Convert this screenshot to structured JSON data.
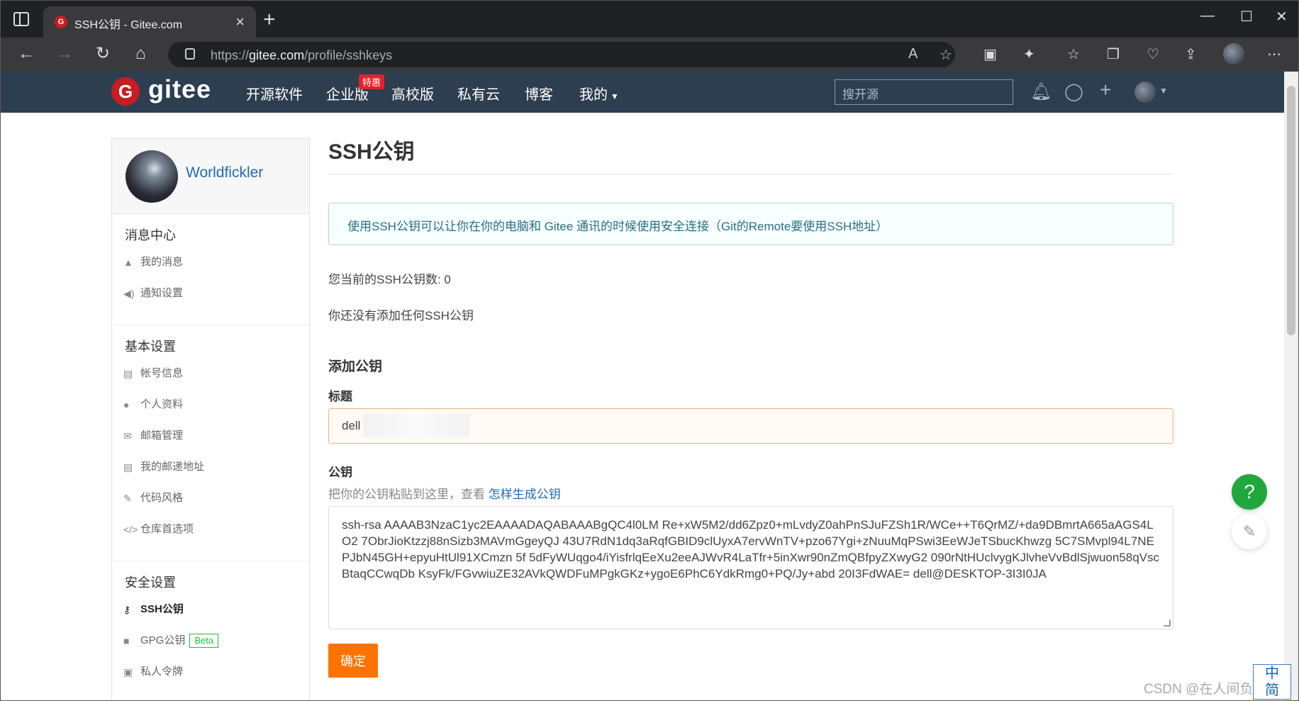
{
  "browser": {
    "tab_title": "SSH公钥 - Gitee.com",
    "tab_close": "×",
    "new_tab": "+",
    "url_prefix": "https://",
    "url_domain": "gitee.com",
    "url_path": "/profile/sshkeys"
  },
  "header": {
    "logo_text": "gitee",
    "logo_mark": "G",
    "nav": [
      "开源软件",
      "企业版",
      "高校版",
      "私有云",
      "博客",
      "我的"
    ],
    "special_badge": "特惠",
    "search_placeholder": "搜开源"
  },
  "sidebar": {
    "username": "Worldfickler",
    "sections": [
      {
        "title": "消息中心",
        "items": [
          {
            "label": "我的消息",
            "icon": "bell-icon"
          },
          {
            "label": "通知设置",
            "icon": "volume-icon"
          }
        ]
      },
      {
        "title": "基本设置",
        "items": [
          {
            "label": "帐号信息",
            "icon": "id-card-icon"
          },
          {
            "label": "个人资料",
            "icon": "user-icon"
          },
          {
            "label": "邮箱管理",
            "icon": "mail-icon"
          },
          {
            "label": "我的邮递地址",
            "icon": "address-card-icon"
          },
          {
            "label": "代码风格",
            "icon": "brush-icon"
          },
          {
            "label": "仓库首选项",
            "icon": "code-icon"
          }
        ]
      },
      {
        "title": "安全设置",
        "items": [
          {
            "label": "SSH公钥",
            "icon": "key-icon",
            "active": true
          },
          {
            "label": "GPG公钥",
            "icon": "lock-icon",
            "badge": "Beta"
          },
          {
            "label": "私人令牌",
            "icon": "briefcase-icon"
          }
        ]
      }
    ]
  },
  "main": {
    "title": "SSH公钥",
    "info": "使用SSH公钥可以让你在你的电脑和 Gitee 通讯的时候使用安全连接（Git的Remote要使用SSH地址）",
    "count_line": "您当前的SSH公钥数: 0",
    "empty_line": "你还没有添加任何SSH公钥",
    "add_title": "添加公钥",
    "title_label": "标题",
    "title_value": "dell",
    "key_label": "公钥",
    "key_hint": "把你的公钥粘贴到这里，查看",
    "key_hint_link": "怎样生成公钥",
    "key_value": "ssh-rsa AAAAB3NzaC1yc2EAAAADAQABAAABgQC4l0LM                    Re+xW5M2/dd6Zpz0+mLvdyZ0ahPnSJuFZSh1R/WCe++T6QrMZ/+da9DBmrtA665aAGS4LO2            7ObrJioKtzzj88nSizb3MAVmGgeyQJ            43U7RdN1dq3aRqfGBID9clUyxA7ervWnTV+pzo67Ygi+zNuuMqPSwi3EeWJeTSbucKhwzg             5C7SMvpl94L7NEPJbN45GH+epyuHtUl91XCmzn                   5f      5dFyWUqgo4/iYisfrlqEeXu2eeAJWvR4LaTfr+5inXwr90nZmQBfpyZXwyG2                  090rNtHUclvygKJlvheVvBdlSjwuon58qVscBtaqCCwqDb                        KsyFk/FGvwiuZE32AVkQWDFuMPgkGKz+ygoE6PhC6YdkRmg0+PQ/Jy+abd              20I3FdWAE= dell@DESKTOP-3I3I0JA",
    "submit": "确定"
  },
  "floating": {
    "help": "?",
    "feedback_icon": "edit-icon"
  },
  "watermark": "CSDN @在人间负债^",
  "ime": "中\n简"
}
